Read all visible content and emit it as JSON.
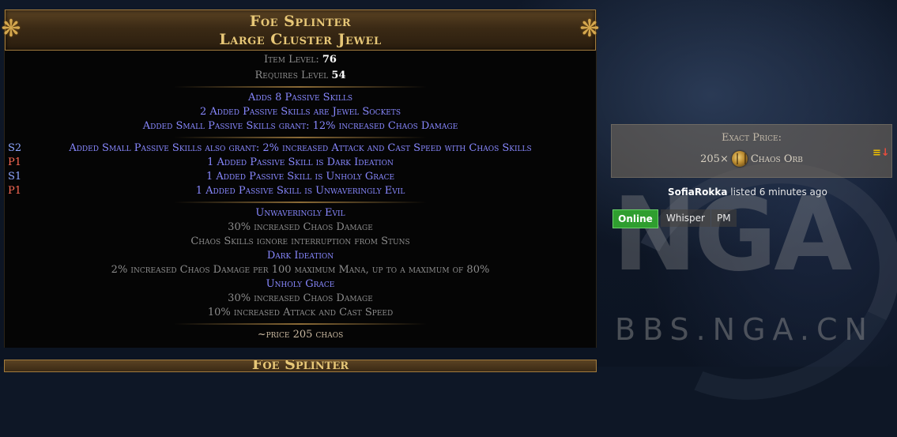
{
  "item": {
    "name": "Foe Splinter",
    "base_type": "Large Cluster Jewel",
    "item_level_label": "Item Level:",
    "item_level_value": "76",
    "requires_label": "Requires Level",
    "requires_value": "54",
    "implicit_mods": [
      "Adds 8 Passive Skills",
      "2 Added Passive Skills are Jewel Sockets",
      "Added Small Passive Skills grant: 12% increased Chaos Damage"
    ],
    "explicit_mods": [
      {
        "tier": "S2",
        "text": "Added Small Passive Skills also grant: 2% increased Attack and Cast Speed with Chaos Skills"
      },
      {
        "tier": "P1",
        "text": "1 Added Passive Skill is Dark Ideation"
      },
      {
        "tier": "S1",
        "text": "1 Added Passive Skill is Unholy Grace"
      },
      {
        "tier": "P1",
        "text": "1 Added Passive Skill is Unwaveringly Evil"
      }
    ],
    "notables": [
      {
        "name": "Unwaveringly Evil",
        "lines": [
          "30% increased Chaos Damage",
          "Chaos Skills ignore interruption from Stuns"
        ]
      },
      {
        "name": "Dark Ideation",
        "lines": [
          "2% increased Chaos Damage per 100 maximum Mana, up to a maximum of 80%"
        ]
      },
      {
        "name": "Unholy Grace",
        "lines": [
          "30% increased Chaos Damage",
          "10% increased Attack and Cast Speed"
        ]
      }
    ],
    "note": "~price 205 chaos",
    "next_item_title": "Foe Splinter"
  },
  "listing": {
    "price_label": "Exact Price:",
    "amount": "205×",
    "currency": "Chaos Orb",
    "currency_icon": "chaos-orb-icon",
    "account": "SofiaRokka",
    "listed_text": "listed 6 minutes ago",
    "status": "Online",
    "whisper_label": "Whisper",
    "pm_label": "PM",
    "sort_icon": "sort-desc-icon"
  },
  "watermark": {
    "logo": "NGA",
    "url": "BBS.NGA.CN"
  },
  "colors": {
    "header_gold": "#e7c777",
    "mod_blue": "#8888ff",
    "tier_suffix": "#8ea6ff",
    "tier_prefix": "#ff6a55",
    "online_green": "#2f9e2f"
  }
}
